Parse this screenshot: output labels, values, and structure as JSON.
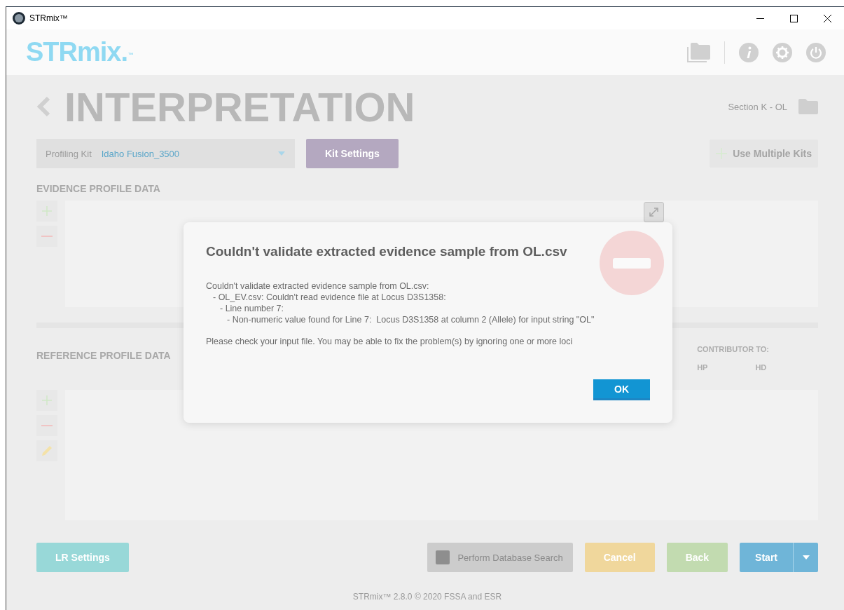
{
  "window": {
    "title": "STRmix™"
  },
  "header": {
    "logo": "STRmix.",
    "logo_mark": "™"
  },
  "page": {
    "title": "INTERPRETATION",
    "case": "Section K - OL"
  },
  "kit": {
    "label": "Profiling Kit",
    "value": "Idaho Fusion_3500",
    "settings_button": "Kit Settings",
    "multiple_kits_button": "Use Multiple Kits"
  },
  "evidence": {
    "heading": "EVIDENCE PROFILE DATA"
  },
  "reference": {
    "heading": "REFERENCE PROFILE DATA",
    "contributor_heading": "CONTRIBUTOR TO:",
    "contributor_columns": [
      "HP",
      "HD"
    ]
  },
  "bottom_bar": {
    "lr_settings": "LR Settings",
    "database_search": {
      "label": "Perform Database Search",
      "checked": false
    },
    "cancel": "Cancel",
    "back": "Back",
    "start": "Start"
  },
  "footer": "STRmix™ 2.8.0 © 2020 FSSA and ESR",
  "dialog": {
    "title": "Couldn't validate extracted evidence sample from OL.csv",
    "message": {
      "text": "Couldn't validate extracted evidence sample from OL.csv:",
      "children": [
        {
          "text": "- OL_EV.csv: Couldn't read evidence file at Locus D3S1358:",
          "children": [
            {
              "text": "- Line number 7:",
              "children": [
                {
                  "text": "- Non-numeric value found for Line 7:  Locus D3S1358 at column 2 (Allele) for input string \"OL\""
                }
              ]
            }
          ]
        }
      ]
    },
    "note": "Please check your input file. You may be able to fix the problem(s) by ignoring one or more loci",
    "ok": "OK"
  }
}
